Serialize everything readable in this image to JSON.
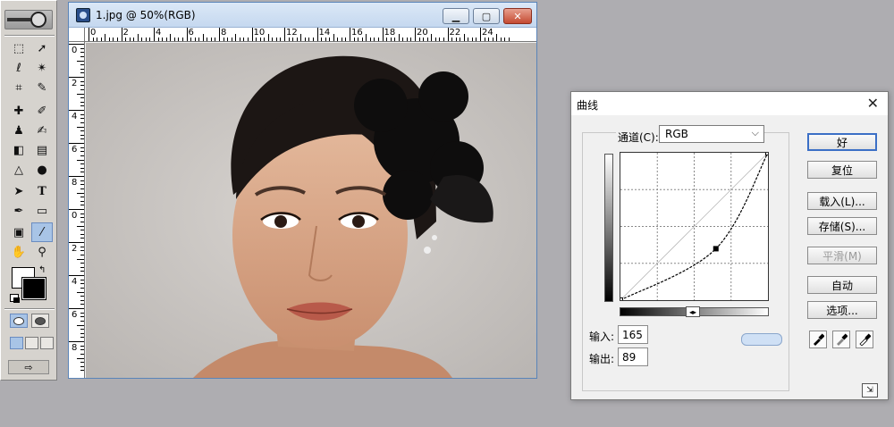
{
  "document": {
    "title": "1.jpg @ 50%(RGB)",
    "ruler_h_labels": [
      "0",
      "2",
      "4",
      "6",
      "8",
      "10",
      "12",
      "14",
      "16",
      "18",
      "20",
      "22",
      "24"
    ],
    "ruler_v_labels": [
      "0",
      "2",
      "4",
      "6",
      "8",
      "0",
      "2",
      "4",
      "6",
      "8"
    ]
  },
  "curves": {
    "title": "曲线",
    "channel_label": "通道(C):",
    "channel_value": "RGB",
    "input_label": "输入:",
    "input_value": "165",
    "output_label": "输出:",
    "output_value": "89",
    "buttons": {
      "ok": "好",
      "reset": "复位",
      "load": "载入(L)...",
      "save": "存储(S)...",
      "smooth": "平滑(M)",
      "auto": "自动",
      "options": "选项..."
    },
    "curve_points": [
      [
        0,
        0
      ],
      [
        165,
        89
      ],
      [
        255,
        255
      ]
    ]
  },
  "toolbox": {
    "tools": [
      "rect-marquee",
      "move",
      "lasso",
      "magic-wand",
      "crop",
      "slice",
      "healing",
      "brush",
      "stamp",
      "history-brush",
      "eraser",
      "gradient",
      "blur",
      "dodge",
      "path-select",
      "type",
      "pen",
      "shape",
      "notes",
      "eyedropper",
      "hand",
      "zoom"
    ],
    "active_tool": "eyedropper",
    "foreground_color": "#ffffff",
    "background_color": "#000000"
  }
}
